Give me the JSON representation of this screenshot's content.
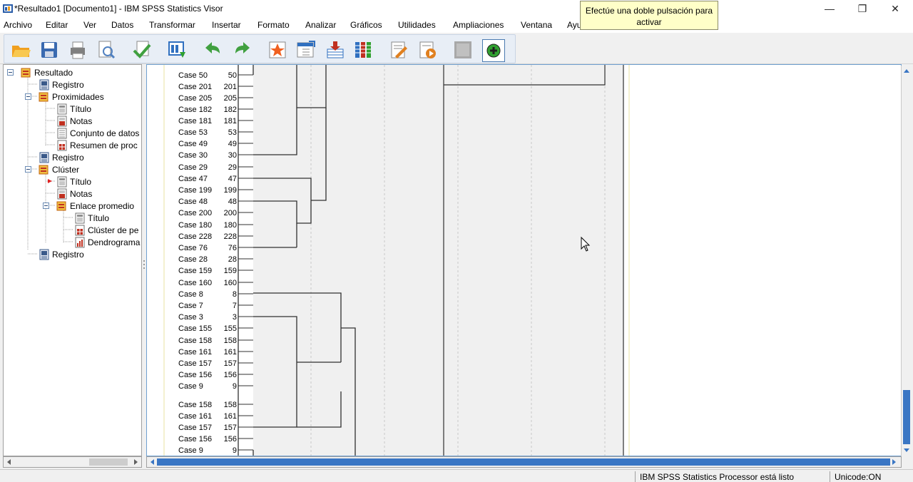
{
  "window": {
    "title": "*Resultado1 [Documento1] - IBM SPSS Statistics Visor",
    "minimize_glyph": "—",
    "restore_glyph": "❐",
    "close_glyph": "✕"
  },
  "menu": [
    {
      "key": "archivo",
      "label": "Archivo"
    },
    {
      "key": "editar",
      "label": "Editar"
    },
    {
      "key": "ver",
      "label": "Ver"
    },
    {
      "key": "datos",
      "label": "Datos"
    },
    {
      "key": "transformar",
      "label": "Transformar"
    },
    {
      "key": "insertar",
      "label": "Insertar"
    },
    {
      "key": "formato",
      "label": "Formato"
    },
    {
      "key": "analizar",
      "label": "Analizar"
    },
    {
      "key": "graficos",
      "label": "Gráficos"
    },
    {
      "key": "utilidades",
      "label": "Utilidades"
    },
    {
      "key": "ampliaciones",
      "label": "Ampliaciones"
    },
    {
      "key": "ventana",
      "label": "Ventana"
    },
    {
      "key": "ayuda",
      "label": "Ayu"
    }
  ],
  "tooltip": "Efectúe una doble pulsación para activar",
  "toolbar": [
    {
      "name": "open-icon",
      "color": "#f0a020"
    },
    {
      "name": "save-icon",
      "color": "#3a6ab0"
    },
    {
      "name": "print-icon",
      "color": "#808080"
    },
    {
      "name": "print-preview-icon",
      "color": "#5080c0"
    },
    {
      "name": "export-icon",
      "color": "#40a040"
    },
    {
      "name": "recall-dialog-icon",
      "color": "#3070c0"
    },
    {
      "name": "undo-icon",
      "color": "#40a040"
    },
    {
      "name": "redo-icon",
      "color": "#40a040"
    },
    {
      "name": "go-to-data-icon",
      "color": "#f06020"
    },
    {
      "name": "go-to-case-icon",
      "color": "#3070c0"
    },
    {
      "name": "go-to-variable-icon",
      "color": "#c03020"
    },
    {
      "name": "variables-icon",
      "color": "#3070c0"
    },
    {
      "name": "insert-heading-icon",
      "color": "#e08020"
    },
    {
      "name": "insert-title-icon",
      "color": "#e08020"
    },
    {
      "name": "show-all-icon",
      "color": "#909090"
    },
    {
      "name": "designate-window-icon",
      "color": "#30a030"
    }
  ],
  "nav_tree": [
    {
      "label": "Resultado",
      "level": 0,
      "icon": "folder-icon",
      "expander": true
    },
    {
      "label": "Registro",
      "level": 1,
      "icon": "log-icon",
      "expander": false
    },
    {
      "label": "Proximidades",
      "level": 1,
      "icon": "folder-icon",
      "expander": true
    },
    {
      "label": "Título",
      "level": 2,
      "icon": "title-icon",
      "expander": false
    },
    {
      "label": "Notas",
      "level": 2,
      "icon": "notes-icon",
      "expander": false
    },
    {
      "label": "Conjunto de datos",
      "level": 2,
      "icon": "dataset-icon",
      "expander": false
    },
    {
      "label": "Resumen de proc",
      "level": 2,
      "icon": "table-icon",
      "expander": false
    },
    {
      "label": "Registro",
      "level": 1,
      "icon": "log-icon",
      "expander": false
    },
    {
      "label": "Clúster",
      "level": 1,
      "icon": "folder-icon",
      "expander": true
    },
    {
      "label": "Título",
      "level": 2,
      "icon": "title-icon",
      "expander": false,
      "current": true
    },
    {
      "label": "Notas",
      "level": 2,
      "icon": "notes-icon",
      "expander": false
    },
    {
      "label": "Enlace promedio",
      "level": 2,
      "icon": "folder-icon",
      "expander": true
    },
    {
      "label": "Título",
      "level": 3,
      "icon": "title-icon",
      "expander": false
    },
    {
      "label": "Clúster de pe",
      "level": 3,
      "icon": "table-icon",
      "expander": false
    },
    {
      "label": "Dendrograma",
      "level": 3,
      "icon": "chart-icon",
      "expander": false
    },
    {
      "label": "Registro",
      "level": 1,
      "icon": "log-icon",
      "expander": false
    }
  ],
  "dendrogram": {
    "cases": [
      {
        "label": "Case 50",
        "id": "50"
      },
      {
        "label": "Case 201",
        "id": "201"
      },
      {
        "label": "Case 205",
        "id": "205"
      },
      {
        "label": "Case 182",
        "id": "182"
      },
      {
        "label": "Case 181",
        "id": "181"
      },
      {
        "label": "Case 53",
        "id": "53"
      },
      {
        "label": "Case 49",
        "id": "49"
      },
      {
        "label": "Case 30",
        "id": "30"
      },
      {
        "label": "Case 29",
        "id": "29"
      },
      {
        "label": "Case 47",
        "id": "47"
      },
      {
        "label": "Case 199",
        "id": "199"
      },
      {
        "label": "Case 48",
        "id": "48"
      },
      {
        "label": "Case 200",
        "id": "200"
      },
      {
        "label": "Case 180",
        "id": "180"
      },
      {
        "label": "Case 228",
        "id": "228"
      },
      {
        "label": "Case 76",
        "id": "76"
      },
      {
        "label": "Case 28",
        "id": "28"
      },
      {
        "label": "Case 159",
        "id": "159"
      },
      {
        "label": "Case 160",
        "id": "160"
      },
      {
        "label": "Case 8",
        "id": "8"
      },
      {
        "label": "Case 7",
        "id": "7"
      },
      {
        "label": "Case 3",
        "id": "3"
      },
      {
        "label": "Case 155",
        "id": "155"
      },
      {
        "label": "Case 158",
        "id": "158"
      },
      {
        "label": "Case 161",
        "id": "161"
      },
      {
        "label": "Case 157",
        "id": "157"
      },
      {
        "label": "Case 156",
        "id": "156"
      },
      {
        "label": "Case 9",
        "id": "9"
      },
      {
        "label": "Case 158",
        "id": "158"
      },
      {
        "label": "Case 161",
        "id": "161"
      },
      {
        "label": "Case 157",
        "id": "157"
      },
      {
        "label": "Case 156",
        "id": "156"
      },
      {
        "label": "Case 9",
        "id": "9"
      }
    ]
  },
  "status": {
    "processor": "IBM SPSS Statistics Processor está listo",
    "encoding": "Unicode:ON"
  },
  "colors": {
    "accent": "#3a76c4",
    "plot_bg": "#f0f0f0",
    "tooltip_bg": "#ffffc8"
  }
}
